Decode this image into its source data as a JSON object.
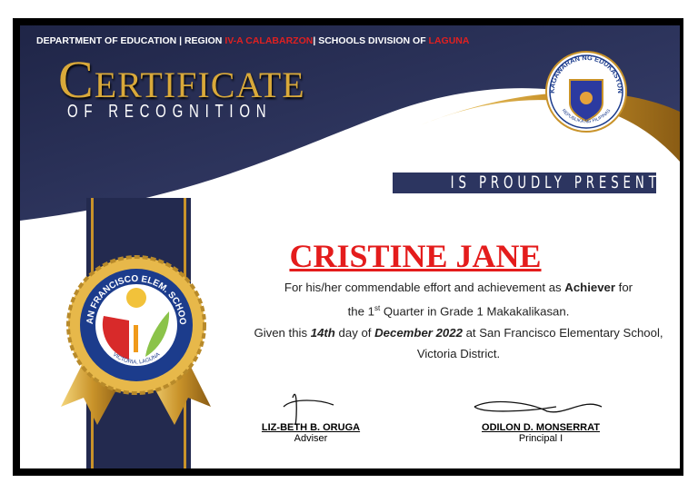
{
  "header": {
    "dept_prefix": "DEPARTMENT OF EDUCATION | REGION ",
    "region": "IV-A CALABARZON",
    "division_prefix": "| SCHOOLS DIVISION OF ",
    "division": "LAGUNA"
  },
  "title": {
    "first_letter": "C",
    "rest": "ERTIFICATE",
    "subtitle": "OF RECOGNITION"
  },
  "deped_seal": {
    "top": "KAGAWARAN NG EDUKASYON",
    "bottom": "REPUBLIKA NG PILIPINAS"
  },
  "school_seal": {
    "top": "SAN FRANCISCO ELEM. SCHOOL",
    "bottom": "VICTORIA, LAGUNA"
  },
  "presented_label": "IS PROUDLY PRESENTED TO",
  "recipient": "CRISTINE JANE",
  "body": {
    "line1_pre": "For his/her commendable effort and achievement as ",
    "award": "Achiever",
    "line1_post": " for",
    "line2_pre": "the 1",
    "ordinal": "st",
    "line2_post": " Quarter in Grade 1 Makakalikasan.",
    "given_pre": "Given this ",
    "day": "14th",
    "given_mid": " day of ",
    "month_year": "December 2022",
    "given_post": " at San Francisco Elementary School, Victoria District."
  },
  "signatories": [
    {
      "name": "LIZ-BETH B. ORUGA",
      "title": "Adviser"
    },
    {
      "name": "ODILON D. MONSERRAT",
      "title": "Principal I"
    }
  ],
  "colors": {
    "navy": "#262d52",
    "gold": "#d9a93a",
    "red": "#e41c1c"
  }
}
